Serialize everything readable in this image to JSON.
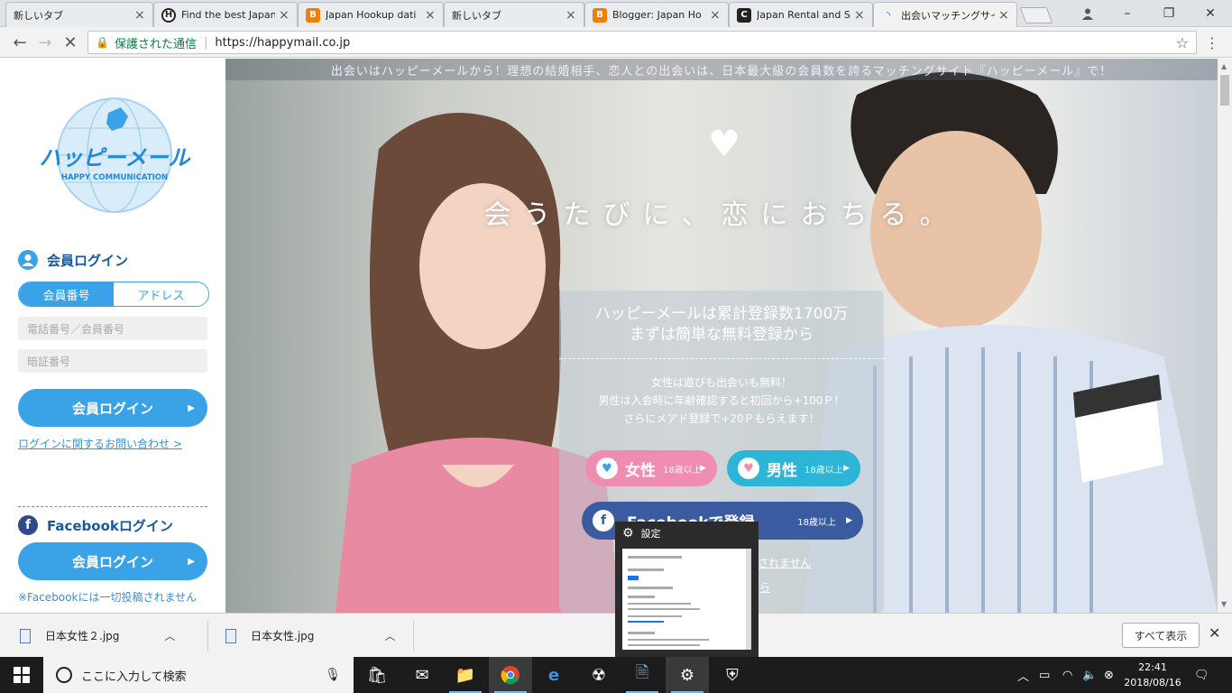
{
  "browser": {
    "tabs": [
      {
        "title": "新しいタブ",
        "icon": "blank",
        "color": "#e9ecef"
      },
      {
        "title": "Find the best Japan",
        "icon": "H",
        "color": "#222222"
      },
      {
        "title": "Japan Hookup dati",
        "icon": "B",
        "color": "#f57d00"
      },
      {
        "title": "新しいタブ",
        "icon": "blank",
        "color": "#e9ecef"
      },
      {
        "title": "Blogger: Japan Ho",
        "icon": "B",
        "color": "#f57d00"
      },
      {
        "title": "Japan Rental and S",
        "icon": "C",
        "color": "#222222"
      },
      {
        "title": "出会いマッチングサイト",
        "icon": "loading",
        "color": "#1a73e8"
      }
    ],
    "secure_label": "保護された通信",
    "url": "https://happymail.co.jp"
  },
  "sidebar": {
    "logo_text": "ハッピーメール",
    "logo_sub": "HAPPY COMMUNICATION",
    "login_title": "会員ログイン",
    "seg_member_no": "会員番号",
    "seg_address": "アドレス",
    "phone_placeholder": "電話番号／会員番号",
    "pin_placeholder": "暗証番号",
    "login_button": "会員ログイン",
    "login_help": "ログインに関するお問い合わせ >",
    "fb_title": "Facebookログイン",
    "fb_login_button": "会員ログイン",
    "fb_note": "※Facebookには一切投稿されません"
  },
  "hero": {
    "top_strip": "出会いはハッピーメールから！理想の結婚相手、恋人との出会いは、日本最大級の会員数を誇るマッチングサイト『ハッピーメール』で！",
    "tagline": "会うたびに、恋におちる。",
    "panel_line1": "ハッピーメールは累計登録数1700万",
    "panel_line2": "まずは簡単な無料登録から",
    "info1": "女性は遊びも出会いも無料！",
    "info2": "男性は入会時に年齢確認すると初回から+100Ｐ！",
    "info3": "さらにメアド登録で+20Ｐもらえます！",
    "female_label": "女性",
    "male_label": "男性",
    "age_note": "18歳以上",
    "fb_register": "Facebookで登録",
    "link1": "されません",
    "link2": "ら"
  },
  "popup": {
    "title": "設定"
  },
  "downloads": {
    "items": [
      {
        "name": "日本女性２.jpg"
      },
      {
        "name": "日本女性.jpg"
      }
    ],
    "show_all": "すべて表示"
  },
  "taskbar": {
    "search_placeholder": "ここに入力して検索",
    "time": "22:41",
    "date": "2018/08/16"
  }
}
